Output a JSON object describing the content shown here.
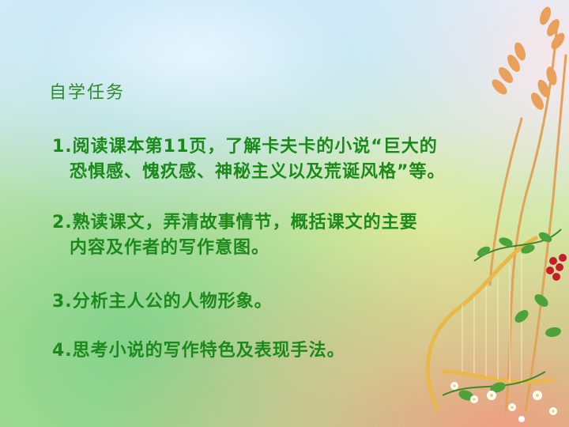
{
  "slide": {
    "heading": "自学任务",
    "tasks": [
      {
        "line1": "1.阅读课本第11页，了解卡夫卡的小说“巨大的",
        "line2": "恐惧感、愧疚感、神秘主义以及荒诞风格”等。"
      },
      {
        "line1": "2.熟读课文，弄清故事情节，概括课文的主要",
        "line2": "内容及作者的写作意图。"
      },
      {
        "line1": "3.分析主人公的人物形象。"
      },
      {
        "line1": "4.思考小说的写作特色及表现手法。"
      }
    ]
  }
}
